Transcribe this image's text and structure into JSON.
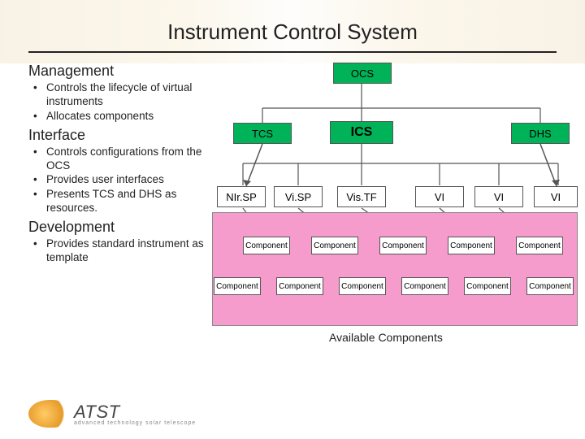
{
  "title": "Instrument Control System",
  "sections": {
    "mgmt": {
      "heading": "Management",
      "items": [
        "Controls the lifecycle of virtual instruments",
        "Allocates components"
      ]
    },
    "iface": {
      "heading": "Interface",
      "items": [
        "Controls configurations from the OCS",
        "Provides user interfaces",
        "Presents TCS and DHS as resources."
      ]
    },
    "dev": {
      "heading": "Development",
      "items": [
        "Provides standard instrument as template"
      ]
    }
  },
  "diagram": {
    "top": {
      "ocs": "OCS"
    },
    "row2": {
      "tcs": "TCS",
      "ics": "ICS",
      "dhs": "DHS"
    },
    "row3": [
      "NIr.SP",
      "Vi.SP",
      "Vis.TF",
      "VI",
      "VI",
      "VI"
    ],
    "compLabel": "Component",
    "avail": "Available Components"
  },
  "logo": {
    "acronym": "ATST",
    "sub": "advanced technology solar telescope"
  },
  "colors": {
    "green": "#00b359",
    "pink": "#f59ccd"
  }
}
